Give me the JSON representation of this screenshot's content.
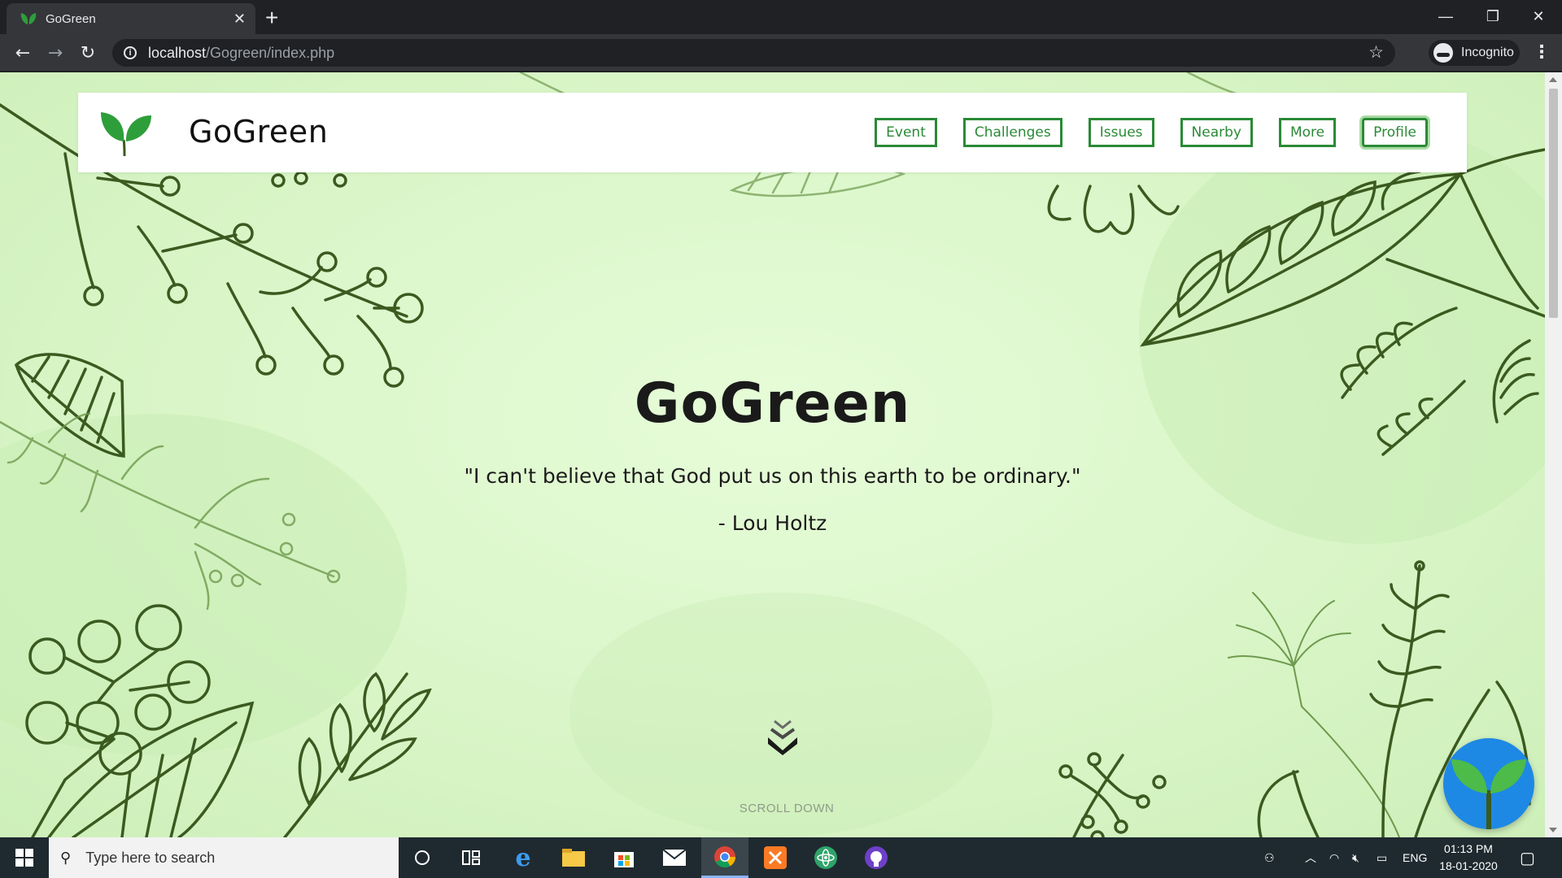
{
  "browser": {
    "tab_title": "GoGreen",
    "new_tab": "+",
    "url_host": "localhost",
    "url_path": "/Gogreen/index.php",
    "profile_label": "Incognito"
  },
  "site": {
    "brand": "GoGreen",
    "nav": [
      {
        "label": "Event"
      },
      {
        "label": "Challenges"
      },
      {
        "label": "Issues"
      },
      {
        "label": "Nearby"
      },
      {
        "label": "More"
      },
      {
        "label": "Profile"
      }
    ],
    "hero_title": "GoGreen",
    "quote": "\"I can't believe that God put us on this earth to be ordinary.\"",
    "author": "- Lou Holtz",
    "scroll_label": "SCROLL DOWN"
  },
  "colors": {
    "accent": "#2a8a36",
    "leaf": "#2e9e3a",
    "line_art": "#3a5a20",
    "background": "#dcf7cb",
    "fab": "#1e88e5"
  },
  "taskbar": {
    "search_placeholder": "Type here to search",
    "language": "ENG",
    "time": "01:13 PM",
    "date": "18-01-2020",
    "apps": [
      "cortana-icon",
      "task-view-icon",
      "edge-icon",
      "file-explorer-icon",
      "store-icon",
      "mail-icon",
      "chrome-icon",
      "xampp-icon",
      "atom-icon",
      "github-icon"
    ]
  }
}
